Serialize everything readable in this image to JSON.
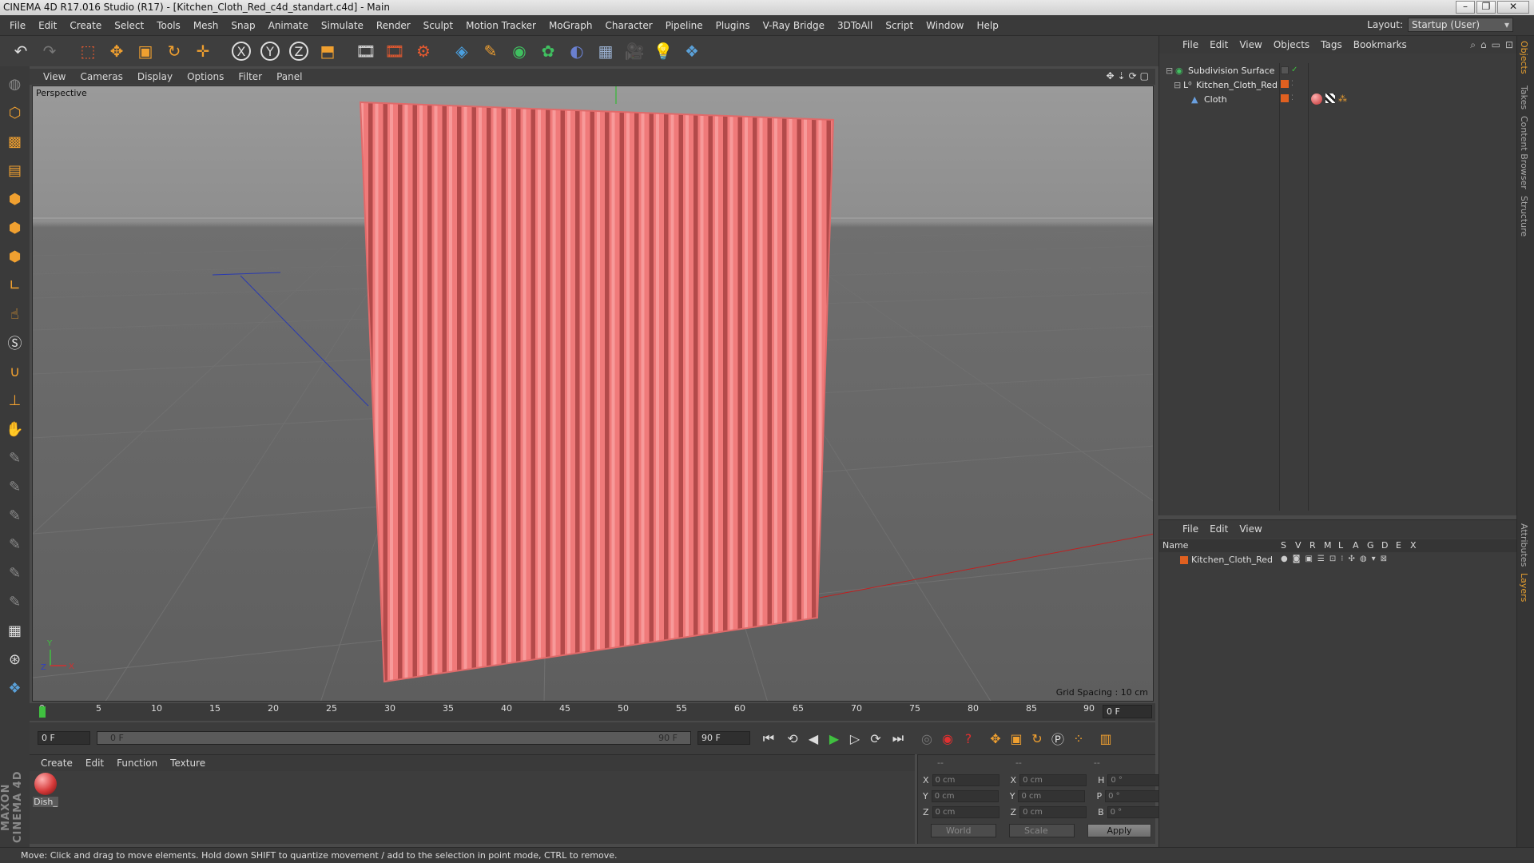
{
  "window": {
    "title": "CINEMA 4D R17.016 Studio (R17) - [Kitchen_Cloth_Red_c4d_standart.c4d] - Main",
    "buttons": [
      "–",
      "❐",
      "✕"
    ]
  },
  "menubar": {
    "items": [
      "File",
      "Edit",
      "Create",
      "Select",
      "Tools",
      "Mesh",
      "Snap",
      "Animate",
      "Simulate",
      "Render",
      "Sculpt",
      "Motion Tracker",
      "MoGraph",
      "Character",
      "Pipeline",
      "Plugins",
      "V-Ray Bridge",
      "3DToAll",
      "Script",
      "Window",
      "Help"
    ],
    "layout_label": "Layout:",
    "layout_value": "Startup (User)"
  },
  "toolbar": {
    "icons": [
      "undo-icon",
      "redo-icon",
      "live-selection-icon",
      "move-icon",
      "scale-icon",
      "rotate-icon",
      "last-tool-icon",
      "x-axis-icon",
      "y-axis-icon",
      "z-axis-icon",
      "coordinate-system-icon",
      "render-view-icon",
      "render-picture-viewer-icon",
      "edit-render-settings-icon",
      "cube-icon",
      "spline-pen-icon",
      "subdivision-icon",
      "array-icon",
      "deformer-icon",
      "floor-icon",
      "camera-icon",
      "light-icon",
      "python-icon"
    ],
    "axis_labels": [
      "X",
      "Y",
      "Z"
    ]
  },
  "viewport": {
    "menu": [
      "View",
      "Cameras",
      "Display",
      "Options",
      "Filter",
      "Panel"
    ],
    "label": "Perspective",
    "grid_spacing": "Grid Spacing : 10 cm",
    "axis_y": "Y",
    "axis_x": "X",
    "axis_z": "Z",
    "cloth_color": "#f07a7a"
  },
  "timeline": {
    "ticks": [
      "0",
      "5",
      "10",
      "15",
      "20",
      "25",
      "30",
      "35",
      "40",
      "45",
      "50",
      "55",
      "60",
      "65",
      "70",
      "75",
      "80",
      "85",
      "90"
    ],
    "current_frame_display": "0 F"
  },
  "transport": {
    "start_frame": "0 F",
    "slider_start": "0 F",
    "slider_end": "90 F",
    "end_frame": "90 F"
  },
  "material_manager": {
    "menu": [
      "Create",
      "Edit",
      "Function",
      "Texture"
    ],
    "materials": [
      {
        "name": "Dish_"
      }
    ]
  },
  "coordinates": {
    "headers": [
      "--",
      "--",
      "--"
    ],
    "rows": [
      {
        "a_label": "X",
        "a_value": "0 cm",
        "b_label": "X",
        "b_value": "0 cm",
        "c_label": "H",
        "c_value": "0 °"
      },
      {
        "a_label": "Y",
        "a_value": "0 cm",
        "b_label": "Y",
        "b_value": "0 cm",
        "c_label": "P",
        "c_value": "0 °"
      },
      {
        "a_label": "Z",
        "a_value": "0 cm",
        "b_label": "Z",
        "b_value": "0 cm",
        "c_label": "B",
        "c_value": "0 °"
      }
    ],
    "mode_select": "World",
    "size_select": "Scale",
    "apply_label": "Apply"
  },
  "object_manager": {
    "menu": [
      "File",
      "Edit",
      "View",
      "Objects",
      "Tags",
      "Bookmarks"
    ],
    "objects": [
      {
        "name": "Subdivision Surface",
        "icon": "subdivision-surface-icon"
      },
      {
        "name": "Kitchen_Cloth_Red",
        "icon": "null-object-icon"
      },
      {
        "name": "Cloth",
        "icon": "polygon-object-icon"
      }
    ]
  },
  "layer_manager": {
    "menu": [
      "File",
      "Edit",
      "View"
    ],
    "columns": [
      "Name",
      "S",
      "V",
      "R",
      "M",
      "L",
      "A",
      "G",
      "D",
      "E",
      "X"
    ],
    "layers": [
      {
        "name": "Kitchen_Cloth_Red",
        "color": "#e06020"
      }
    ]
  },
  "right_tabs": [
    "Objects",
    "Takes",
    "Content Browser",
    "Structure",
    "Attributes",
    "Layers"
  ],
  "status": {
    "text": "Move: Click and drag to move elements. Hold down SHIFT to quantize movement / add to the selection in point mode, CTRL to remove."
  },
  "branding": {
    "logo_text": "MAXON CINEMA 4D"
  }
}
